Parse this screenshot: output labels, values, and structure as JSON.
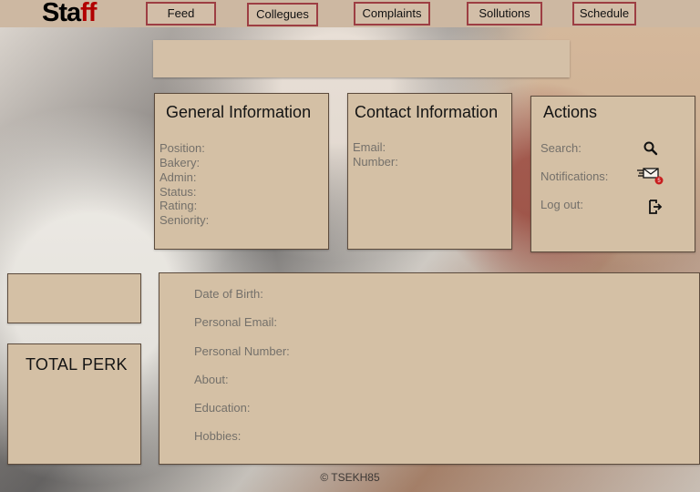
{
  "app": {
    "title_part1": "Sta",
    "title_part2": "ff"
  },
  "nav": [
    {
      "label": "Feed"
    },
    {
      "label": "Collegues"
    },
    {
      "label": "Complaints"
    },
    {
      "label": "Sollutions"
    },
    {
      "label": "Schedule"
    }
  ],
  "general": {
    "title": "General Information",
    "fields": [
      "Position:",
      "Bakery:",
      "Admin:",
      "Status:",
      "Rating:",
      "Seniority:"
    ]
  },
  "contact": {
    "title": "Contact Information",
    "fields": [
      "Email:",
      "Number:"
    ]
  },
  "actions": {
    "title": "Actions",
    "items": [
      {
        "label": "Search:",
        "icon": "search-icon"
      },
      {
        "label": "Notifications:",
        "icon": "mail-icon",
        "badge": "5"
      },
      {
        "label": "Log out:",
        "icon": "logout-icon"
      }
    ]
  },
  "perk": {
    "title": "TOTAL PERK"
  },
  "profile": {
    "fields": [
      "Date of Birth:",
      "Personal Email:",
      "Personal Number:",
      "About:",
      "Education:",
      "Hobbies:"
    ]
  },
  "footer": {
    "text": "© TSEKH85"
  },
  "colors": {
    "panel": "#d4c0a5",
    "topbar": "#cdb8a2",
    "nav_border": "#9d3e43",
    "accent": "#b10000"
  }
}
